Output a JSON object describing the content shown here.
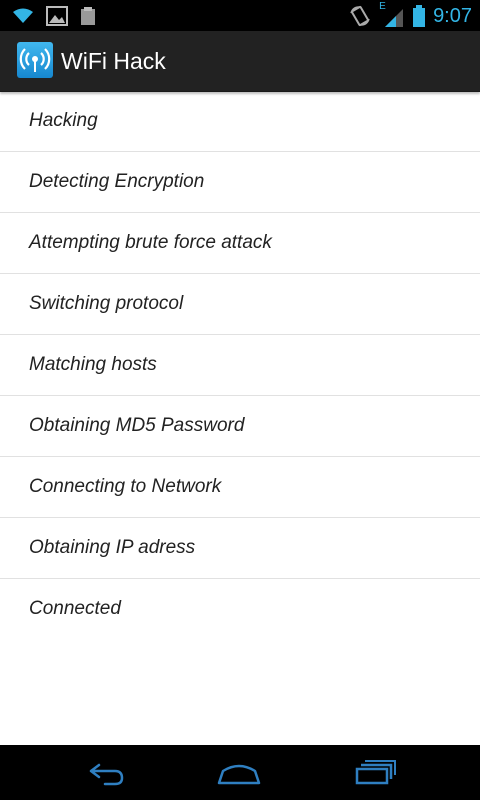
{
  "status_bar": {
    "time": "9:07",
    "network_type": "E",
    "icons": [
      "wifi-icon",
      "image-icon",
      "clipboard-icon",
      "rotate-icon",
      "signal-icon",
      "battery-icon"
    ]
  },
  "app": {
    "title": "WiFi Hack",
    "icon": "wifi-broadcast-icon",
    "accent": "#33b5e5"
  },
  "list": {
    "items": [
      {
        "label": "Hacking"
      },
      {
        "label": "Detecting Encryption"
      },
      {
        "label": "Attempting brute force attack"
      },
      {
        "label": "Switching protocol"
      },
      {
        "label": "Matching hosts"
      },
      {
        "label": "Obtaining MD5 Password"
      },
      {
        "label": "Connecting to Network"
      },
      {
        "label": "Obtaining IP adress"
      },
      {
        "label": "Connected"
      }
    ]
  },
  "nav_bar": {
    "icons": [
      "back-icon",
      "home-icon",
      "recent-apps-icon"
    ]
  }
}
